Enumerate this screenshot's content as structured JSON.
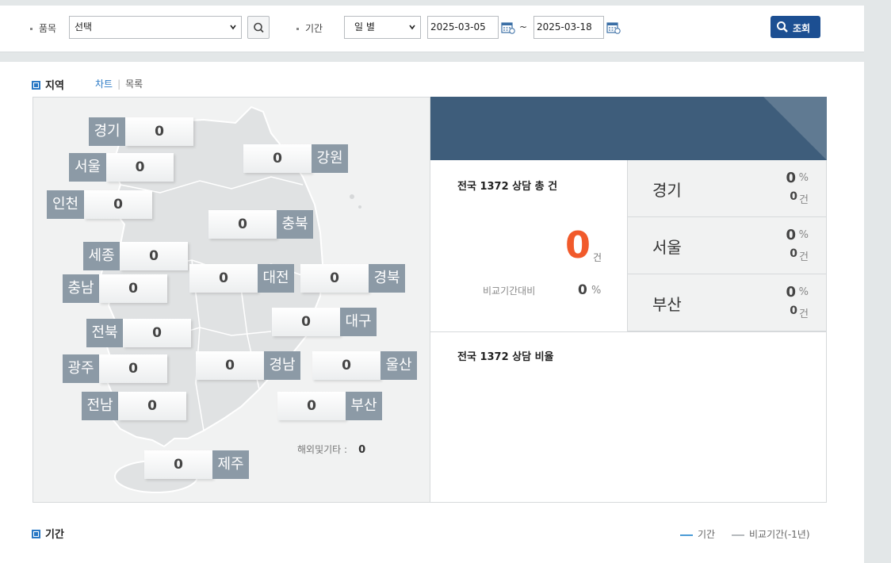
{
  "filter": {
    "item_label": "품목",
    "item_value": "선택",
    "period_label": "기간",
    "period_value": "일 별",
    "date_from": "2025-03-05",
    "date_sep": "~",
    "date_to": "2025-03-18",
    "search_label": "조회"
  },
  "region_section": {
    "title": "지역",
    "tabs": {
      "chart": "차트",
      "separator": "|",
      "list": "목록"
    },
    "regions": [
      {
        "name": "경기",
        "value": "0"
      },
      {
        "name": "서울",
        "value": "0"
      },
      {
        "name": "인천",
        "value": "0"
      },
      {
        "name": "강원",
        "value": "0"
      },
      {
        "name": "충북",
        "value": "0"
      },
      {
        "name": "세종",
        "value": "0"
      },
      {
        "name": "충남",
        "value": "0"
      },
      {
        "name": "대전",
        "value": "0"
      },
      {
        "name": "경북",
        "value": "0"
      },
      {
        "name": "대구",
        "value": "0"
      },
      {
        "name": "전북",
        "value": "0"
      },
      {
        "name": "광주",
        "value": "0"
      },
      {
        "name": "경남",
        "value": "0"
      },
      {
        "name": "울산",
        "value": "0"
      },
      {
        "name": "전남",
        "value": "0"
      },
      {
        "name": "부산",
        "value": "0"
      },
      {
        "name": "제주",
        "value": "0"
      }
    ],
    "overseas_label": "해외및기타 :",
    "overseas_value": "0"
  },
  "stats": {
    "total_title": "전국 1372 상담 총 건",
    "total_value": "0",
    "total_unit": "건",
    "compare_label": "비교기간대비",
    "compare_value": "0",
    "compare_unit": "%",
    "top": [
      {
        "name": "경기",
        "percent": "0",
        "percent_unit": "%",
        "count": "0",
        "count_unit": "건"
      },
      {
        "name": "서울",
        "percent": "0",
        "percent_unit": "%",
        "count": "0",
        "count_unit": "건"
      },
      {
        "name": "부산",
        "percent": "0",
        "percent_unit": "%",
        "count": "0",
        "count_unit": "건"
      }
    ],
    "ratio_title": "전국 1372 상담 비율"
  },
  "period_section": {
    "title": "기간",
    "legend": [
      {
        "label": "기간",
        "color": "#4a9bd6"
      },
      {
        "label": "비교기간(-1년)",
        "color": "#b5b9bd"
      }
    ]
  },
  "colors": {
    "accent": "#1c4f92",
    "highlight": "#f15a2b",
    "header": "#3e5d7b"
  }
}
